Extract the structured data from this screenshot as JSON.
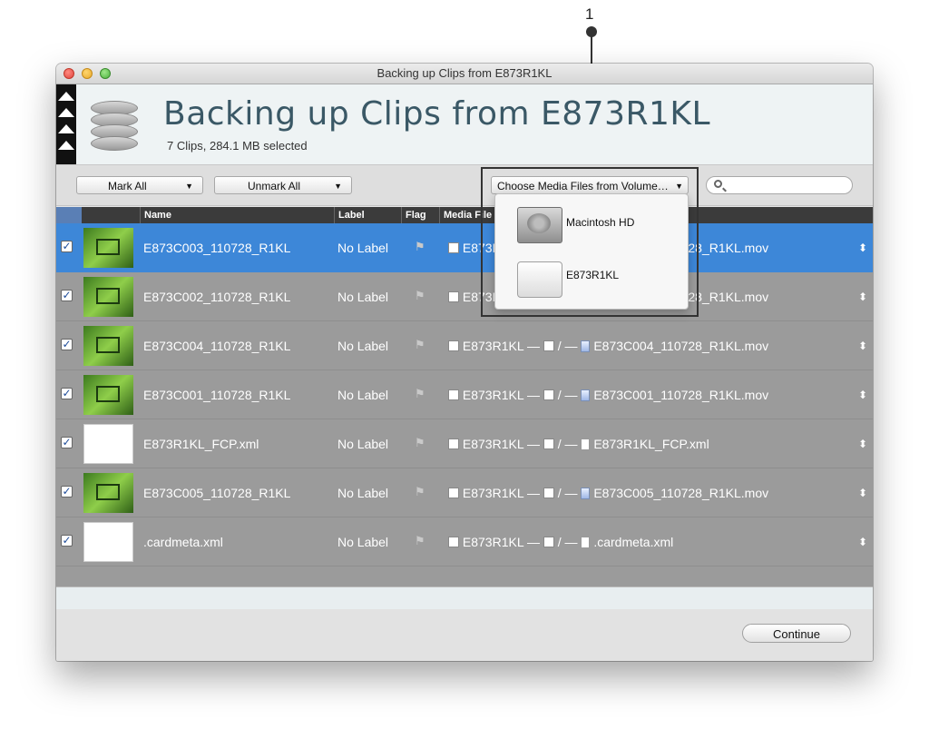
{
  "callout": {
    "number": "1"
  },
  "window": {
    "title": "Backing up Clips from E873R1KL",
    "header_title": "Backing up Clips from E873R1KL",
    "header_subtitle": "7 Clips, 284.1 MB selected"
  },
  "toolbar": {
    "mark_all": "Mark All",
    "unmark_all": "Unmark All",
    "volume_select": "Choose Media Files from Volume…",
    "search_placeholder": ""
  },
  "table": {
    "columns": {
      "name": "Name",
      "label": "Label",
      "flag": "Flag",
      "media": "Media File"
    },
    "rows": [
      {
        "name": "E873C003_110728_R1KL",
        "label": "No Label",
        "path": "E873R1KL — ",
        "sep": " / — ",
        "file": "E873C003_110728_R1KL.mov",
        "selected": true,
        "kind": "mov"
      },
      {
        "name": "E873C002_110728_R1KL",
        "label": "No Label",
        "path": "E873R1KL — ",
        "sep": " / — ",
        "file": "E873C002_110728_R1KL.mov",
        "selected": false,
        "kind": "mov"
      },
      {
        "name": "E873C004_110728_R1KL",
        "label": "No Label",
        "path": "E873R1KL — ",
        "sep": " / — ",
        "file": "E873C004_110728_R1KL.mov",
        "selected": false,
        "kind": "mov"
      },
      {
        "name": "E873C001_110728_R1KL",
        "label": "No Label",
        "path": "E873R1KL — ",
        "sep": " / — ",
        "file": "E873C001_110728_R1KL.mov",
        "selected": false,
        "kind": "mov"
      },
      {
        "name": "E873R1KL_FCP.xml",
        "label": "No Label",
        "path": "E873R1KL — ",
        "sep": " / — ",
        "file": "E873R1KL_FCP.xml",
        "selected": false,
        "kind": "doc"
      },
      {
        "name": "E873C005_110728_R1KL",
        "label": "No Label",
        "path": "E873R1KL — ",
        "sep": " / — ",
        "file": "E873C005_110728_R1KL.mov",
        "selected": false,
        "kind": "mov"
      },
      {
        "name": ".cardmeta.xml",
        "label": "No Label",
        "path": "E873R1KL — ",
        "sep": " / — ",
        "file": ".cardmeta.xml",
        "selected": false,
        "kind": "doc"
      }
    ]
  },
  "dropdown": {
    "items": [
      {
        "label": "Macintosh HD",
        "icon": "hard-drive-icon"
      },
      {
        "label": "E873R1KL",
        "icon": "external-drive-icon"
      }
    ]
  },
  "footer": {
    "continue_label": "Continue"
  },
  "colors": {
    "selection": "#3d87d8",
    "row_bg": "#9b9b9b",
    "header_title": "#3a5866"
  }
}
